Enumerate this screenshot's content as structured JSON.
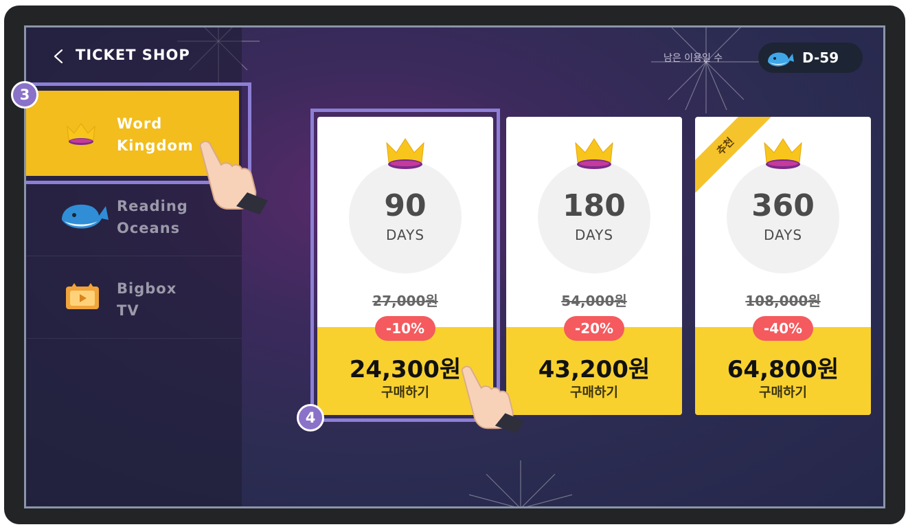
{
  "header": {
    "title": "TICKET SHOP",
    "remaining_label": "남은 이용일 수",
    "dday": "D-59"
  },
  "sidebar": {
    "items": [
      {
        "line1": "Word",
        "line2": "Kingdom",
        "icon": "crown-icon",
        "active": true
      },
      {
        "line1": "Reading",
        "line2": "Oceans",
        "icon": "whale-icon",
        "active": false
      },
      {
        "line1": "Bigbox",
        "line2": "TV",
        "icon": "tv-icon",
        "active": false
      }
    ]
  },
  "tickets": [
    {
      "days": "90",
      "unit": "DAYS",
      "original": "27,000원",
      "discount": "-10%",
      "price": "24,300원",
      "buy": "구매하기"
    },
    {
      "days": "180",
      "unit": "DAYS",
      "original": "54,000원",
      "discount": "-20%",
      "price": "43,200원",
      "buy": "구매하기"
    },
    {
      "days": "360",
      "unit": "DAYS",
      "original": "108,000원",
      "discount": "-40%",
      "price": "64,800원",
      "buy": "구매하기",
      "ribbon": "추천"
    }
  ],
  "steps": {
    "step3": "3",
    "step4": "4"
  },
  "colors": {
    "accent_yellow": "#f2bd1d",
    "discount_red": "#f45a5e",
    "highlight_purple": "#8d7fd6"
  }
}
